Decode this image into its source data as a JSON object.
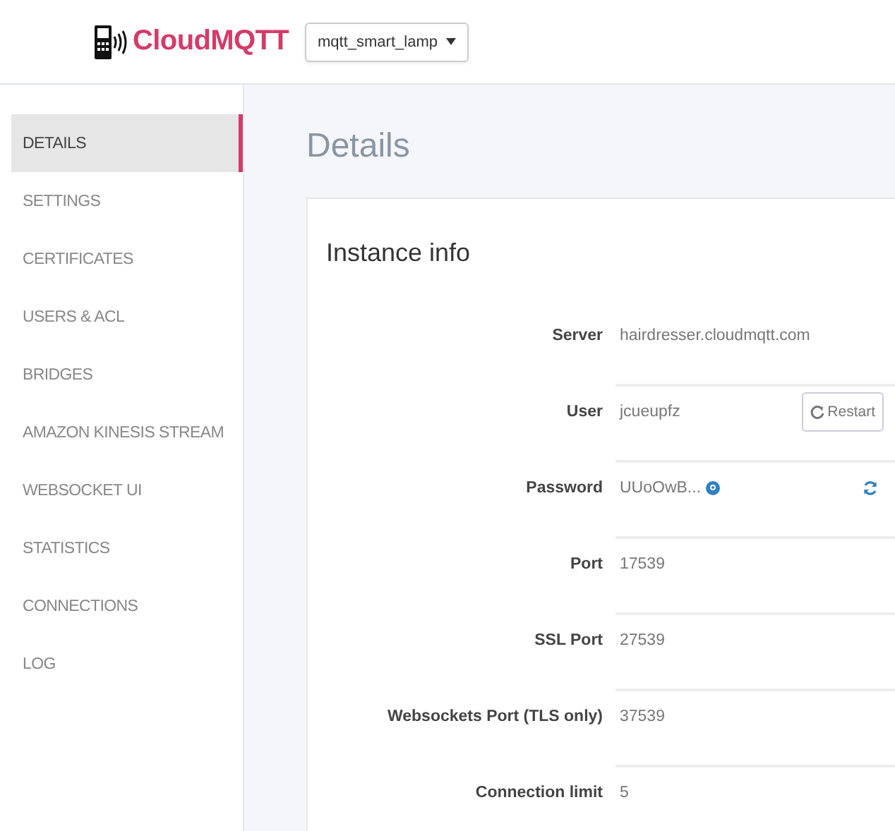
{
  "header": {
    "logo_text": "CloudMQTT",
    "instance_select": "mqtt_smart_lamp"
  },
  "sidebar": {
    "items": [
      {
        "label": "DETAILS",
        "selected": true
      },
      {
        "label": "SETTINGS",
        "selected": false
      },
      {
        "label": "CERTIFICATES",
        "selected": false
      },
      {
        "label": "USERS & ACL",
        "selected": false
      },
      {
        "label": "BRIDGES",
        "selected": false
      },
      {
        "label": "AMAZON KINESIS STREAM",
        "selected": false
      },
      {
        "label": "WEBSOCKET UI",
        "selected": false
      },
      {
        "label": "STATISTICS",
        "selected": false
      },
      {
        "label": "CONNECTIONS",
        "selected": false
      },
      {
        "label": "LOG",
        "selected": false
      }
    ]
  },
  "page_title": "Details",
  "card": {
    "title": "Instance info",
    "rows": [
      {
        "kind": "plain",
        "label": "Server",
        "value": "hairdresser.cloudmqtt.com"
      },
      {
        "kind": "action",
        "label": "User",
        "value": "jcueupfz",
        "button": "Restart"
      },
      {
        "kind": "secret",
        "label": "Password",
        "value": "UUoOwB..."
      },
      {
        "kind": "plain",
        "label": "Port",
        "value": "17539"
      },
      {
        "kind": "plain",
        "label": "SSL Port",
        "value": "27539"
      },
      {
        "kind": "plain",
        "label": "Websockets Port (TLS only)",
        "value": "37539"
      },
      {
        "kind": "plain",
        "label": "Connection limit",
        "value": "5"
      }
    ]
  }
}
